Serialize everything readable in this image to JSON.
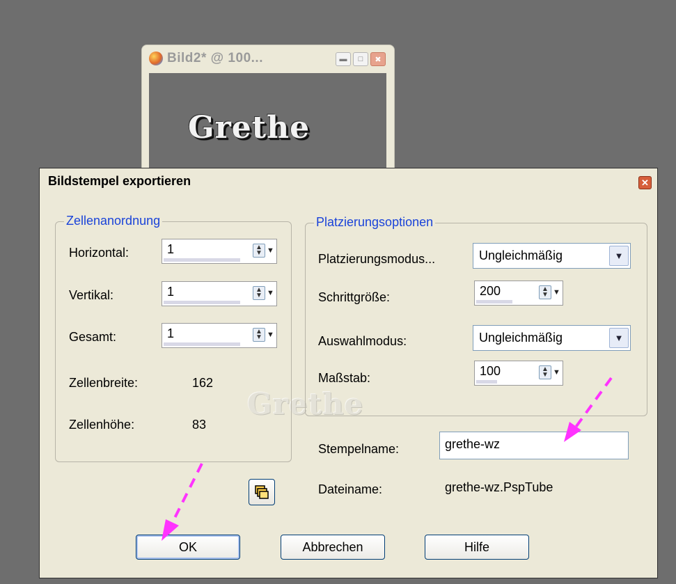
{
  "background_window": {
    "title": "Bild2* @ 100...",
    "canvas_text": "Grethe",
    "minimize_icon": "minimize-icon",
    "maximize_icon": "maximize-icon",
    "close_icon": "close-icon"
  },
  "dialog": {
    "title": "Bildstempel exportieren",
    "watermark": "Grethe",
    "cell_group": {
      "legend": "Zellenanordnung",
      "horizontal_label": "Horizontal:",
      "horizontal_value": "1",
      "vertical_label": "Vertikal:",
      "vertical_value": "1",
      "total_label": "Gesamt:",
      "total_value": "1",
      "cell_width_label": "Zellenbreite:",
      "cell_width_value": "162",
      "cell_height_label": "Zellenhöhe:",
      "cell_height_value": "83"
    },
    "placement_group": {
      "legend": "Platzierungsoptionen",
      "mode_label": "Platzierungsmodus...",
      "mode_value": "Ungleichmäßig",
      "step_label": "Schrittgröße:",
      "step_value": "200",
      "selection_label": "Auswahlmodus:",
      "selection_value": "Ungleichmäßig",
      "scale_label": "Maßstab:",
      "scale_value": "100"
    },
    "stamp_name_label": "Stempelname:",
    "stamp_name_value": "grethe-wz",
    "filename_label": "Dateiname:",
    "filename_value": "grethe-wz.PspTube",
    "buttons": {
      "ok": "OK",
      "cancel": "Abbrechen",
      "help": "Hilfe"
    }
  },
  "colors": {
    "desktop": "#6e6e6e",
    "dialog_bg": "#ece9d8",
    "legend_text": "#1a43d9",
    "annotation_arrow": "#ff33ff"
  }
}
